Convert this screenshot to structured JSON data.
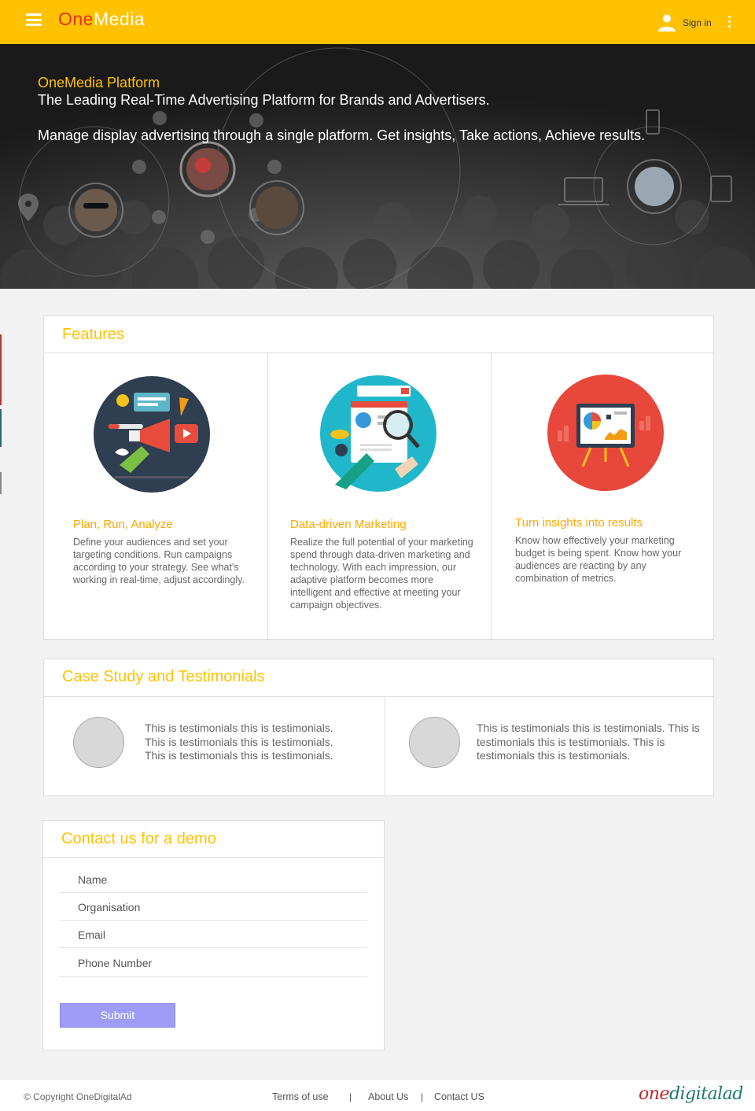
{
  "header": {
    "brand_part1": "One",
    "brand_part2": "Media",
    "signin_label": "Sign in"
  },
  "hero": {
    "title": "OneMedia Platform",
    "subtitle": "The Leading Real-Time Advertising Platform for Brands and Advertisers.",
    "description": "Manage display advertising through a single platform. Get insights, Take actions, Achieve results."
  },
  "features": {
    "heading": "Features",
    "items": [
      {
        "title": "Plan, Run, Analyze",
        "text": "Define your audiences and set your targeting conditions. Run campaigns according to your strategy. See what's working in real-time, adjust accordingly.",
        "icon": "marketing-megaphone-illustration"
      },
      {
        "title": "Data-driven Marketing",
        "text": "Realize the full potential of your marketing spend through data-driven marketing and technology. With each impression, our adaptive platform becomes more intelligent and effective at meeting your campaign objectives.",
        "icon": "data-search-illustration"
      },
      {
        "title": "Turn insights into results",
        "text": "Know how effectively your marketing budget is being spent.  Know how your audiences are reacting by any combination of metrics.",
        "icon": "report-presentation-illustration"
      }
    ]
  },
  "testimonials": {
    "heading": "Case Study and Testimonials",
    "items": [
      {
        "text": "This is testimonials this is testimonials. This is testimonials this is testimonials. This is testimonials this is testimonials."
      },
      {
        "text": "This is testimonials this is testimonials. This is testimonials this is testimonials. This is testimonials this is testimonials."
      }
    ]
  },
  "contact": {
    "heading": "Contact us for a demo",
    "fields": [
      "Name",
      "Organisation",
      "Email",
      "Phone Number"
    ],
    "submit_label": "Submit"
  },
  "footer": {
    "copyright": "© Copyright OneDigitalAd",
    "links": [
      "Terms of use",
      "About Us",
      "Contact US"
    ],
    "separator": "|",
    "logo_part1": "one",
    "logo_part2": "digitalad"
  },
  "colors": {
    "header_bg": "#ffc200",
    "accent_yellow": "#ffc200",
    "feature_title": "#ffa800",
    "submit_bg": "#9e9cf6",
    "brand_red": "#e0301e",
    "logo_teal": "#1e7a72"
  }
}
